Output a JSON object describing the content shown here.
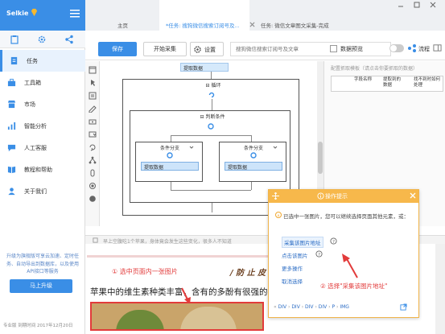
{
  "brand": {
    "name": "Selkie"
  },
  "tabs": [
    {
      "label": "主页"
    },
    {
      "label": "*任务: 搜狗微信搜索订阅号及..."
    },
    {
      "label": "任务: 微信文章图文采集-完成"
    }
  ],
  "sidebar": {
    "items": [
      {
        "label": "任务",
        "icon": "document-icon"
      },
      {
        "label": "工具箱",
        "icon": "toolbox-icon"
      },
      {
        "label": "市场",
        "icon": "market-icon"
      },
      {
        "label": "智能分析",
        "icon": "analysis-icon"
      },
      {
        "label": "人工客服",
        "icon": "service-icon"
      },
      {
        "label": "教程和帮助",
        "icon": "book-icon"
      },
      {
        "label": "关于我们",
        "icon": "person-icon"
      }
    ],
    "promo": "升级为旗舰版可享云加速、定时任务、自动导出到数据库，以及使用API接口等服务",
    "upgrade_label": "马上升级",
    "edition": "专业版  到期时间 2017年12月20日"
  },
  "toolbar": {
    "save_label": "保存",
    "start_label": "开始采集",
    "settings_label": "设置",
    "url_placeholder": "搜狗微信搜索订阅号及文章",
    "preview_label": "数据预览",
    "flow_label": "流程"
  },
  "flow": {
    "top_node": "提取数据",
    "loop_label": "循环",
    "branch_label": "判断条件",
    "branch_left_label": "条件分支",
    "branch_right_label": "条件分支",
    "left_node": "提取数据",
    "right_node": "提取数据"
  },
  "field_panel": {
    "hint": "配置抓取模板（请点击你要抓取的数据）",
    "columns": [
      "字段名称",
      "提取到的数据",
      "找不到时如何处理"
    ]
  },
  "browser": {
    "url_hint": "早上空腹吃1个苹果，身体竟会发生这些变化，很多人不知道",
    "annotation_1": "① 选中页面内一张图片",
    "banner": "/ 防 止 皮 肤",
    "text": "苹果中的维生素种类丰富，含有的多酚有很强的抗氧"
  },
  "popup": {
    "title": "操作提示",
    "message": "已选中一张图片，您可以继续选择页面其他元素，或：",
    "options": [
      {
        "label": "采集该图片地址"
      },
      {
        "label": "点击该图片"
      },
      {
        "label": "更多操作"
      },
      {
        "label": "取消选择"
      }
    ],
    "path": [
      "DIV",
      "DIV",
      "DIV",
      "DIV",
      "P",
      "IMG"
    ],
    "annotation_2": "② 选择\"采集该图片地址\""
  }
}
